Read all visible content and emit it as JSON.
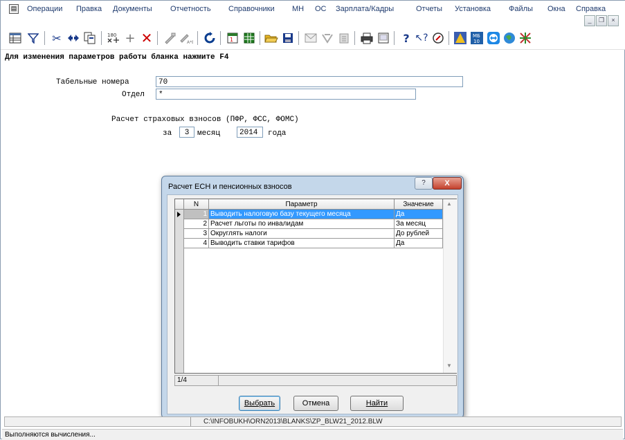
{
  "menu": {
    "items": [
      "Операции",
      "Правка",
      "Документы",
      "Отчетность",
      "Справочники",
      "МН",
      "ОС",
      "Зарплата/Кадры",
      "Отчеты",
      "Установка",
      "Файлы",
      "Окна",
      "Справка"
    ]
  },
  "window_buttons": {
    "minimize": "_",
    "restore": "❐",
    "close": "×"
  },
  "toolbar": {
    "icons": [
      "table-icon",
      "filter-icon",
      "cut-icon",
      "move-icon",
      "copy-icon",
      "calculator-icon",
      "add-icon",
      "delete-icon",
      "replace-icon",
      "replace-all-icon",
      "refresh-icon",
      "calendar-icon",
      "spreadsheet-icon",
      "open-folder-icon",
      "save-icon",
      "send-icon",
      "mail-icon",
      "archive-icon",
      "print-icon",
      "preview-icon",
      "help-icon",
      "context-help-icon",
      "compass-icon",
      "assistant-icon",
      "mb-icon",
      "teamviewer-icon",
      "globe-icon",
      "network-icon"
    ],
    "badge_text": "180"
  },
  "form": {
    "hint": "Для изменения параметров работы бланка нажмите F4",
    "tabel_label": "Табельные номера",
    "tabel_value": "70",
    "otdel_label": "Отдел",
    "otdel_value": "*",
    "calc_title": "Расчет страховых взносов (ПФР, ФСС, ФОМС)",
    "za_label": "за",
    "month_value": "3",
    "month_label": "месяц",
    "year_value": "2014",
    "year_label": "года"
  },
  "dialog": {
    "title": "Расчет ЕСН и пенсионных взносов",
    "help_label": "?",
    "close_label": "X",
    "columns": {
      "n": "N",
      "param": "Параметр",
      "value": "Значение"
    },
    "rows": [
      {
        "n": "1",
        "param": "Выводить налоговую базу текущего месяца",
        "value": "Да",
        "selected": true
      },
      {
        "n": "2",
        "param": "Расчет льготы по инвалидам",
        "value": "За месяц",
        "selected": false
      },
      {
        "n": "3",
        "param": "Округлять налоги",
        "value": "До рублей",
        "selected": false
      },
      {
        "n": "4",
        "param": "Выводить ставки тарифов",
        "value": "Да",
        "selected": false
      }
    ],
    "record_position": "1/4",
    "buttons": {
      "select": "Выбрать",
      "cancel": "Отмена",
      "find": "Найти"
    },
    "selection_color": "#3399ff"
  },
  "pathbar": {
    "path": "C:\\INFOBUKH\\ORN2013\\BLANKS\\ZP_BLW21_2012.BLW"
  },
  "statusbar": {
    "text": "Выполняются вычисления..."
  }
}
